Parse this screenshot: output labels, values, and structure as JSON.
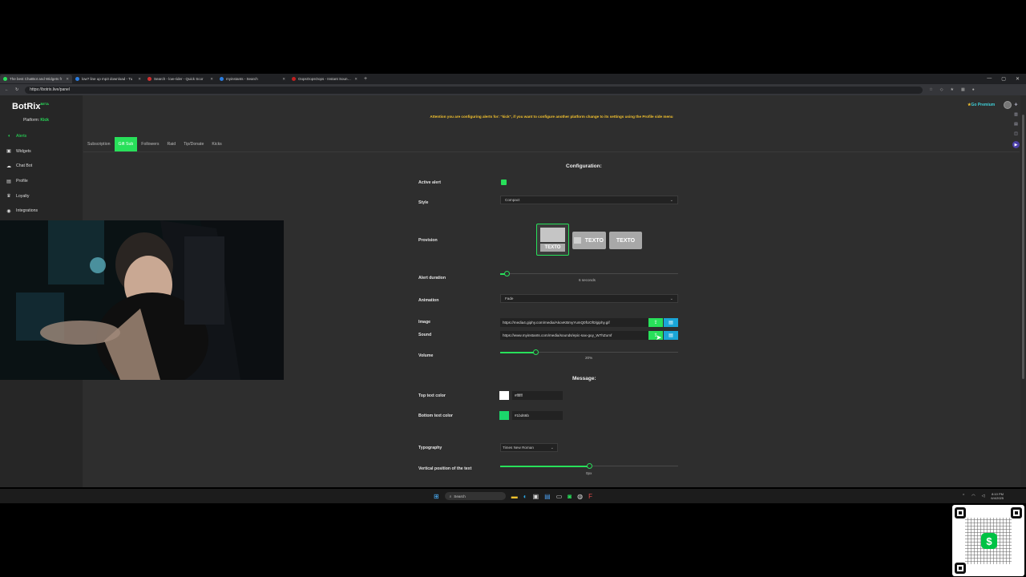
{
  "browser": {
    "tabs": [
      {
        "label": "The best ChatBot and Widgets fr",
        "color": "#28e05a",
        "active": true
      },
      {
        "label": "low? line up mp3 download - Tu",
        "color": "#2a7de1",
        "active": false
      },
      {
        "label": "Search - low-rider - Quick Scor",
        "color": "#d03030",
        "active": false
      },
      {
        "label": "myinstants - Search",
        "color": "#2a7de1",
        "active": false
      },
      {
        "label": "OopsOopsOops - Instant Sound Bu",
        "color": "#c02020",
        "active": false
      }
    ],
    "url": "https://botrix.live/panel"
  },
  "app": {
    "logo": "BotRix",
    "beta": "BETA",
    "platform_label": "Platform:",
    "platform_value": "Kick",
    "premium": "Go Premium",
    "banner": "Attention you are configuring alerts for: \"kick\", if you want to configure another platform change to its settings using the Profile side menu",
    "nav": [
      {
        "label": "Alerts",
        "icon": "bell-icon",
        "glyph": "◖",
        "active": true
      },
      {
        "label": "Widgets",
        "icon": "widgets-icon",
        "glyph": "▣",
        "active": false
      },
      {
        "label": "Chat Bot",
        "icon": "robot-icon",
        "glyph": "☁",
        "active": false
      },
      {
        "label": "Profile",
        "icon": "user-icon",
        "glyph": "▤",
        "active": false
      },
      {
        "label": "Loyalty",
        "icon": "trophy-icon",
        "glyph": "♛",
        "active": false
      },
      {
        "label": "Integrations",
        "icon": "integrations-icon",
        "glyph": "◉",
        "active": false
      }
    ],
    "tabs": [
      "Subscription",
      "Gift Sub",
      "Followers",
      "Raid",
      "Tip/Donate",
      "Kicks"
    ],
    "active_tab": 1
  },
  "form": {
    "title": "Configuration:",
    "active_alert_label": "Active alert",
    "style_label": "Style",
    "style_value": "Compact",
    "provision_label": "Provision",
    "provision_text": "TEXTO",
    "duration_label": "Alert duration",
    "duration_value": "6 seconds",
    "duration_fraction": 0.04,
    "animation_label": "Animation",
    "animation_value": "Fade",
    "image_label": "Image",
    "image_url": "https://media4.giphy.com/media/AkovKBmyYumQ0fUOf0/giphy.gif",
    "sound_label": "Sound",
    "sound_url": "https://www.myinstants.com/media/sounds/epic-sax-guy_W7hZumf",
    "volume_label": "Volume",
    "volume_value": "20%",
    "volume_fraction": 0.2,
    "message_title": "Message:",
    "top_color_label": "Top text color",
    "top_color_value": "#ffffff",
    "bottom_color_label": "Bottom text color",
    "bottom_color_value": "#1bd66b",
    "typography_label": "Typography",
    "typography_value": "Times New Roman",
    "vpos_label": "Vertical position of the text",
    "vpos_value": "0px",
    "vpos_fraction": 0.5
  },
  "taskbar": {
    "search": "Search",
    "time": "8:10 PM",
    "date": "6/4/2025"
  },
  "colors": {
    "accent": "#28e05a",
    "warning": "#f2c12e",
    "button_blue": "#1aa6d8"
  }
}
